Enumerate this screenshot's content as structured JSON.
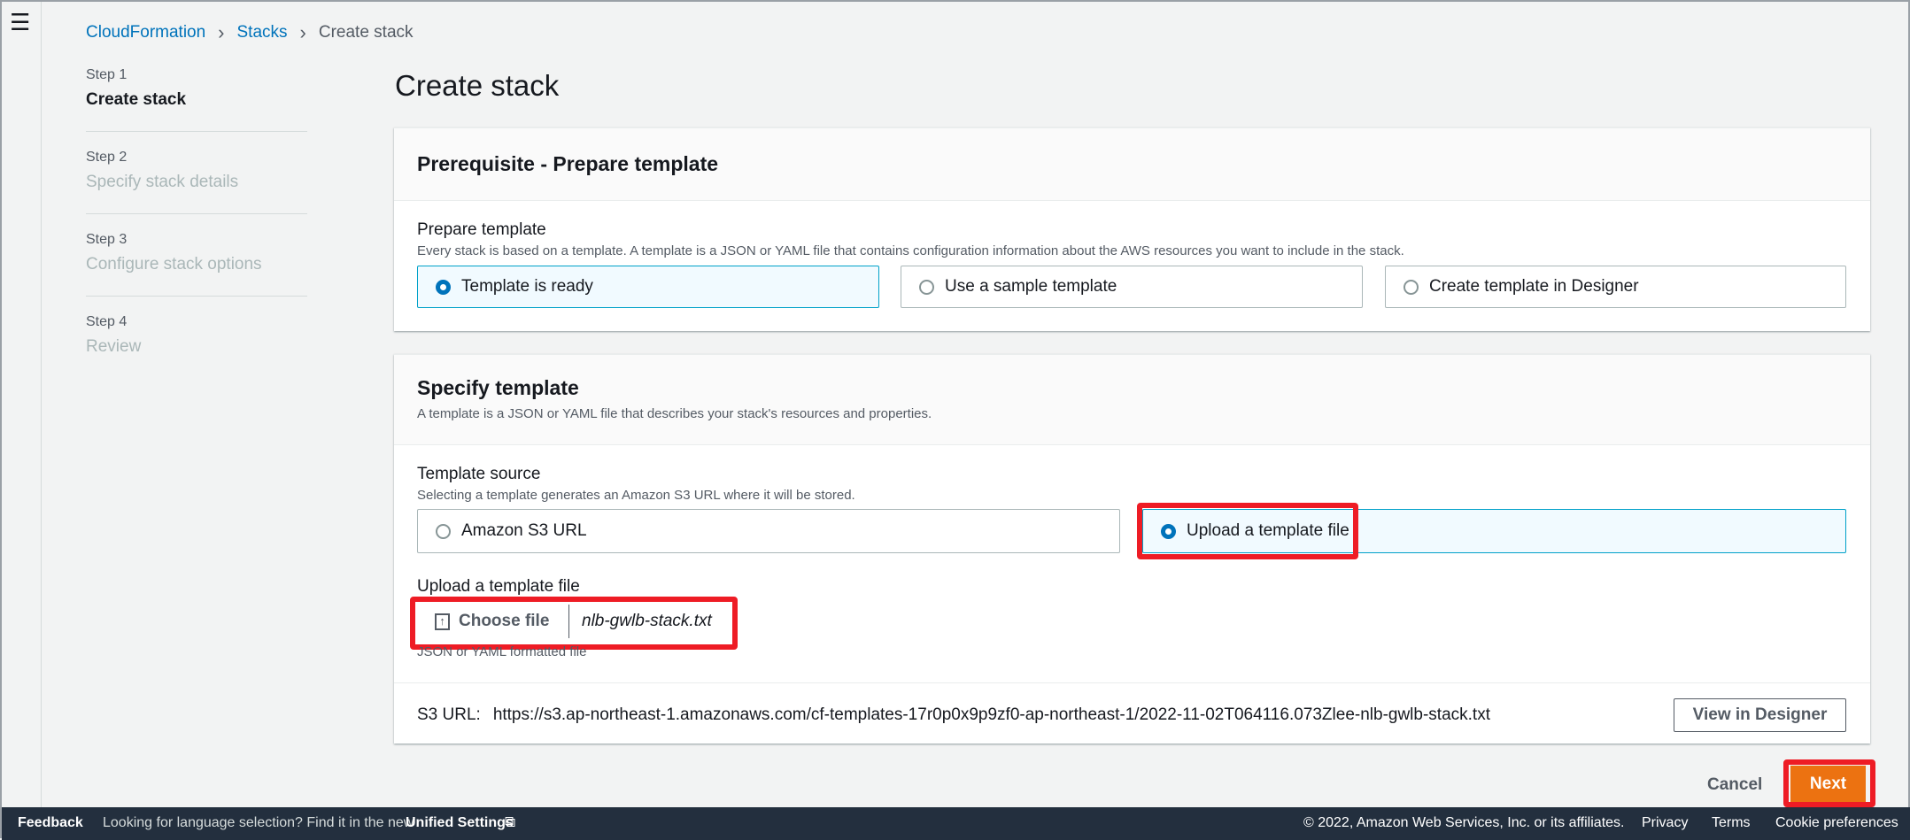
{
  "nav": {
    "menu_icon": "hamburger-icon"
  },
  "breadcrumb": {
    "items": [
      "CloudFormation",
      "Stacks",
      "Create stack"
    ]
  },
  "steps": [
    {
      "num": "Step 1",
      "name": "Create stack",
      "active": true
    },
    {
      "num": "Step 2",
      "name": "Specify stack details"
    },
    {
      "num": "Step 3",
      "name": "Configure stack options"
    },
    {
      "num": "Step 4",
      "name": "Review"
    }
  ],
  "page_title": "Create stack",
  "prereq": {
    "title": "Prerequisite - Prepare template",
    "label": "Prepare template",
    "desc": "Every stack is based on a template. A template is a JSON or YAML file that contains configuration information about the AWS resources you want to include in the stack.",
    "options": [
      "Template is ready",
      "Use a sample template",
      "Create template in Designer"
    ],
    "selected": "Template is ready"
  },
  "specify": {
    "title": "Specify template",
    "desc": "A template is a JSON or YAML file that describes your stack's resources and properties.",
    "source_label": "Template source",
    "source_desc": "Selecting a template generates an Amazon S3 URL where it will be stored.",
    "options": [
      "Amazon S3 URL",
      "Upload a template file"
    ],
    "selected": "Upload a template file",
    "upload_label": "Upload a template file",
    "choose_file": "Choose file",
    "file_name": "nlb-gwlb-stack.txt",
    "hint": "JSON or YAML formatted file",
    "s3_label": "S3 URL:",
    "s3_url": "https://s3.ap-northeast-1.amazonaws.com/cf-templates-17r0p0x9p9zf0-ap-northeast-1/2022-11-02T064116.073Zlee-nlb-gwlb-stack.txt",
    "view_designer": "View in Designer"
  },
  "actions": {
    "cancel": "Cancel",
    "next": "Next"
  },
  "footer": {
    "feedback": "Feedback",
    "lang_text": "Looking for language selection? Find it in the new",
    "unified": "Unified Settings",
    "copyright": "© 2022, Amazon Web Services, Inc. or its affiliates.",
    "privacy": "Privacy",
    "terms": "Terms",
    "cookies": "Cookie preferences"
  },
  "colors": {
    "accent": "#0073bb",
    "primary_button": "#ec7211",
    "highlight": "#ee1c25",
    "footer_bg": "#232f3e"
  }
}
